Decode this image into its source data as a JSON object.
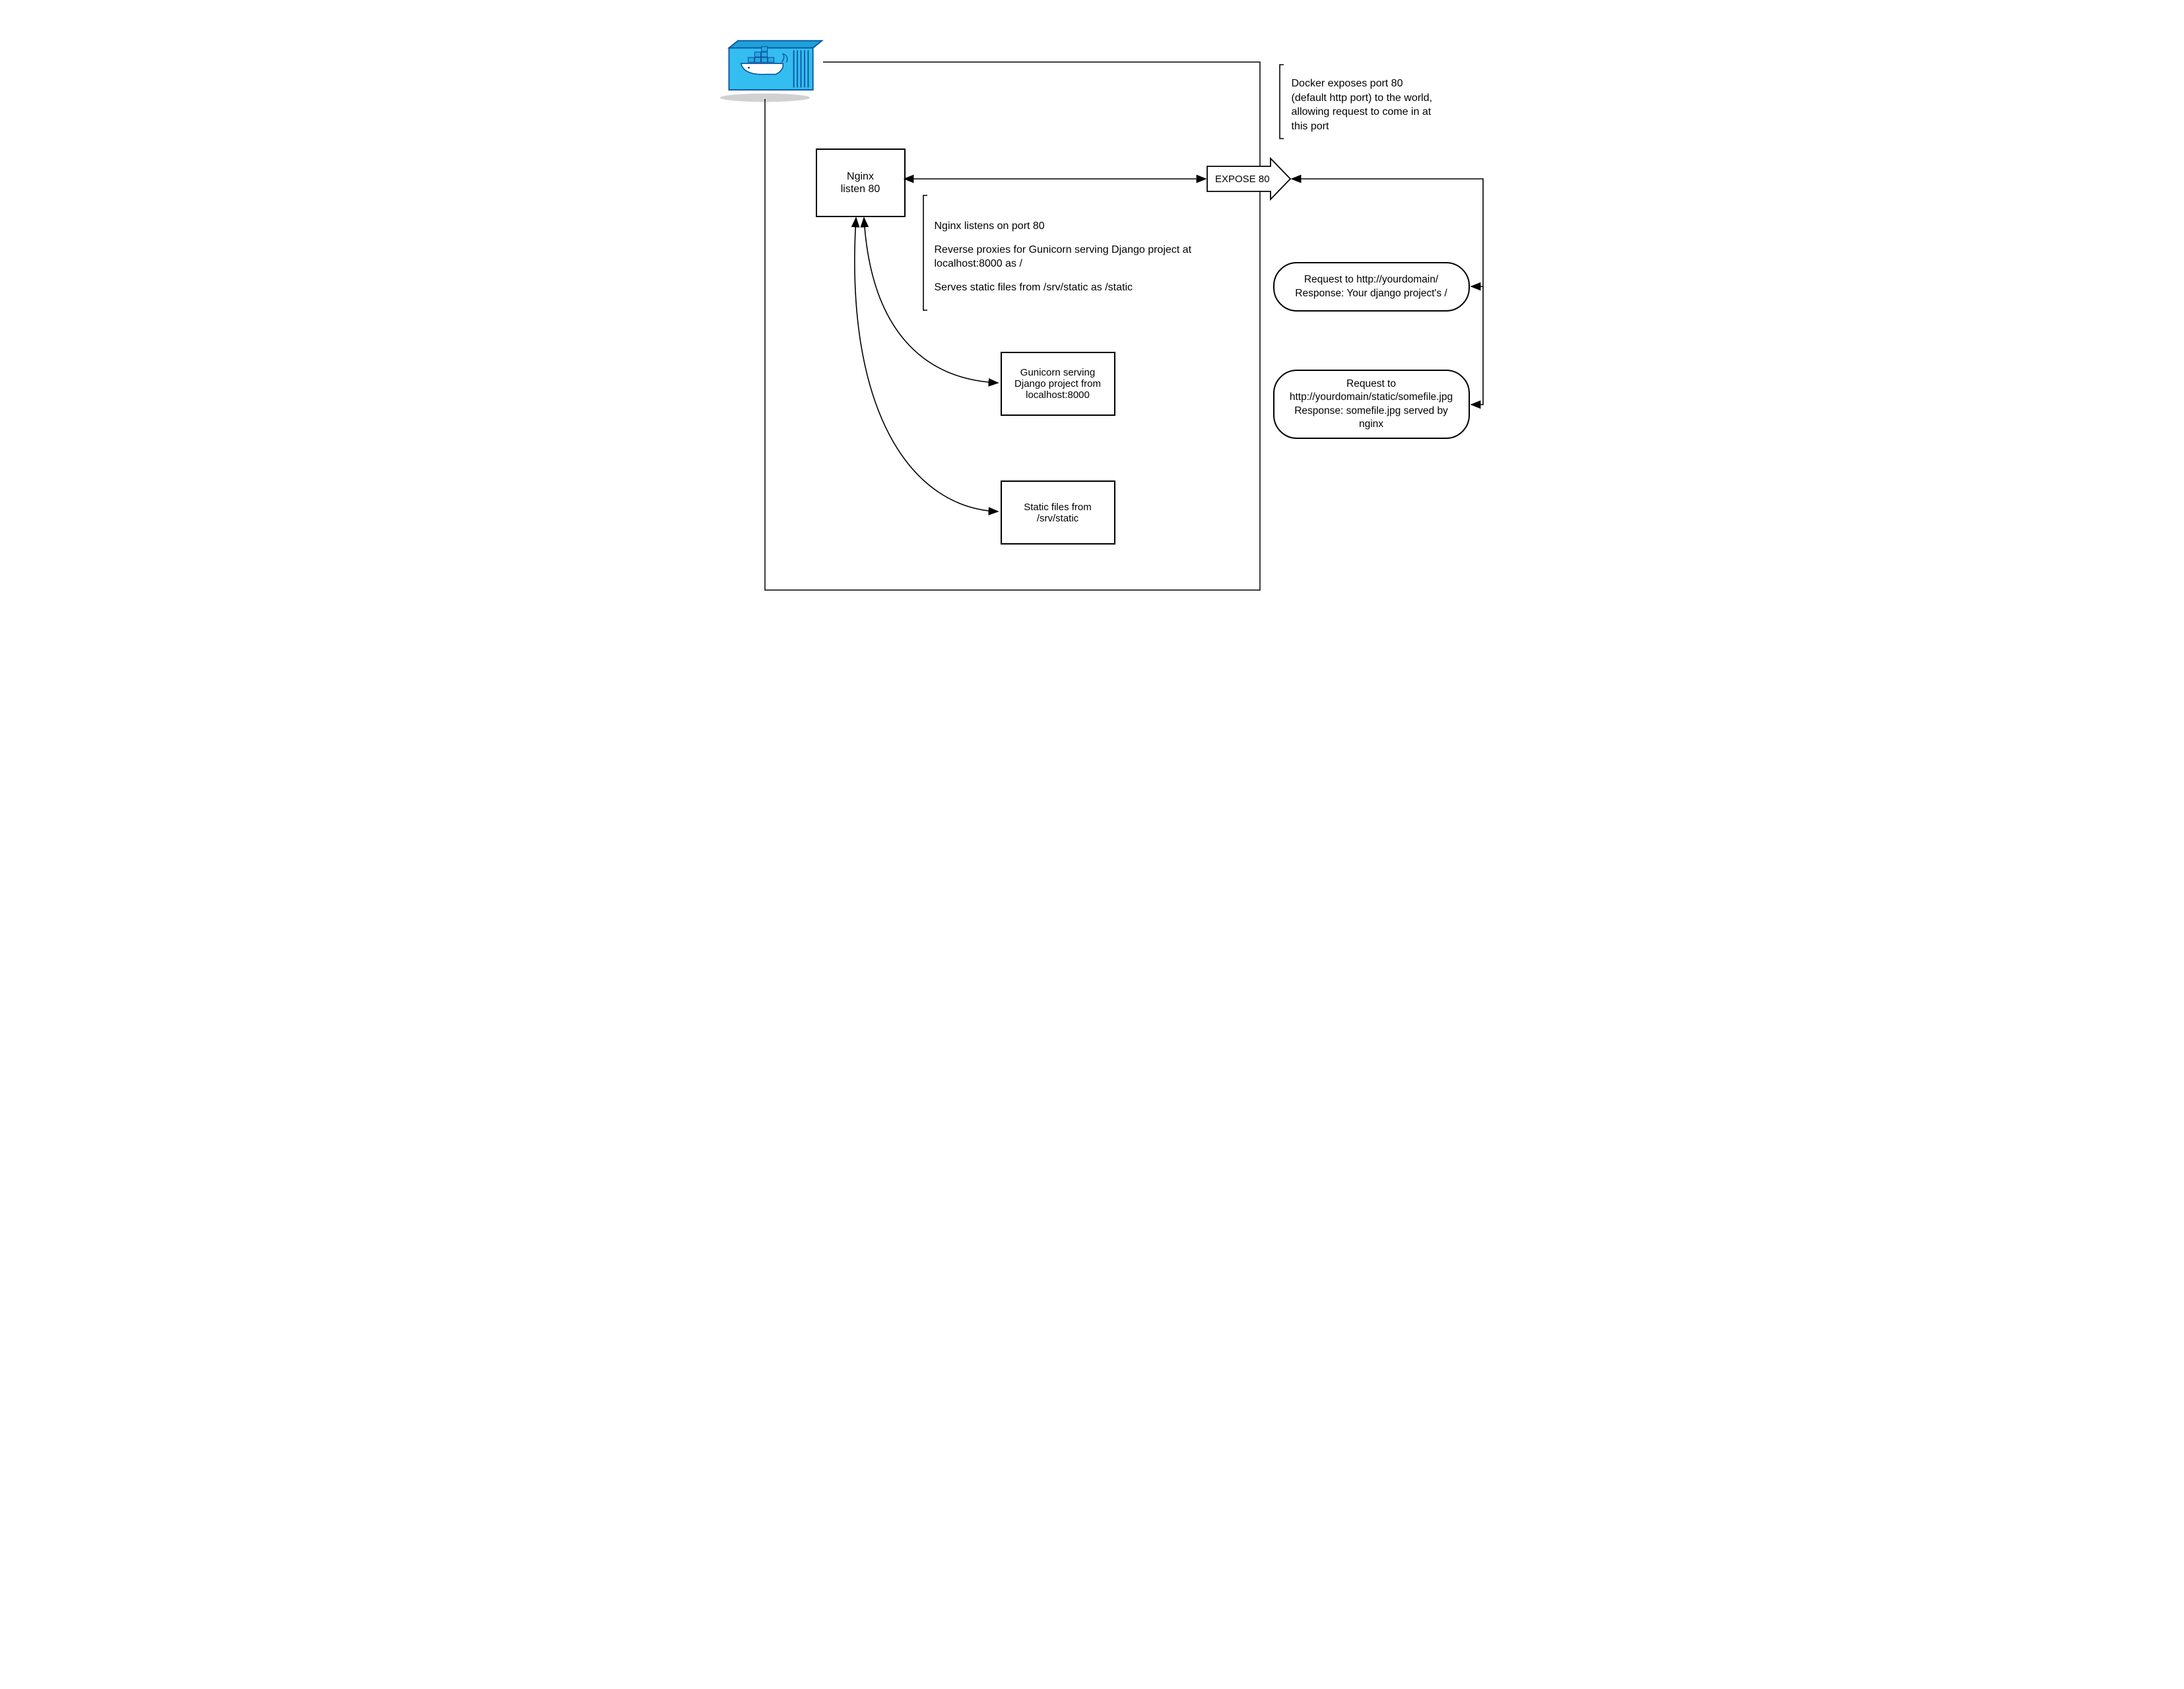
{
  "nginx": {
    "line1": "Nginx",
    "line2": "listen 80"
  },
  "expose_label": "EXPOSE 80",
  "gunicorn": "Gunicorn serving Django project from localhost:8000",
  "static_files": "Static files from /srv/static",
  "docker_note": "Docker exposes port 80 (default http port) to the world, allowing request to come in at this port",
  "nginx_note": {
    "p1": "Nginx listens on port 80",
    "p2": "Reverse proxies for Gunicorn serving Django project at localhost:8000 as /",
    "p3": "Serves static files from /srv/static as /static"
  },
  "request_root": {
    "l1": "Request to http://yourdomain/",
    "l2": "Response: Your django project's /"
  },
  "request_static": {
    "l1": "Request to",
    "l2": "http://yourdomain/static/somefile.jpg",
    "l3": "Response: somefile.jpg served by nginx"
  }
}
